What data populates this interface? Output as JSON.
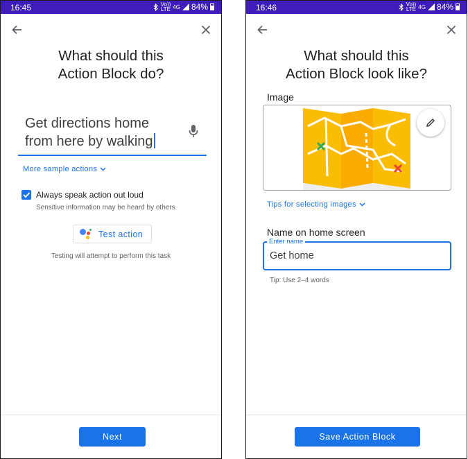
{
  "screen1": {
    "status": {
      "time": "16:45",
      "battery": "84%",
      "net_top": "Vo))",
      "net_bottom": "LTE",
      "signal": "4G"
    },
    "title_line1": "What should this",
    "title_line2": "Action Block do?",
    "query_line1": "Get directions home",
    "query_line2": "from here by walking",
    "more_sample": "More sample actions",
    "checkbox_label": "Always speak action out loud",
    "checkbox_checked": true,
    "checkbox_sub": "Sensitive information may be heard by others",
    "test_button": "Test action",
    "test_note": "Testing will attempt to perform this task",
    "next_button": "Next"
  },
  "screen2": {
    "status": {
      "time": "16:46",
      "battery": "84%",
      "net_top": "Vo))",
      "net_bottom": "LTE",
      "signal": "4G"
    },
    "title_line1": "What should this",
    "title_line2": "Action Block look like?",
    "image_label": "Image",
    "tips_link": "Tips for selecting images",
    "name_label": "Name on home screen",
    "field_label": "Enter name",
    "field_value": "Get home",
    "tip": "Tip: Use 2–4 words",
    "save_button": "Save Action Block"
  },
  "colors": {
    "status_bar": "#3f1dbd",
    "accent": "#1a73e8",
    "map_yellow": "#fbbc04"
  }
}
